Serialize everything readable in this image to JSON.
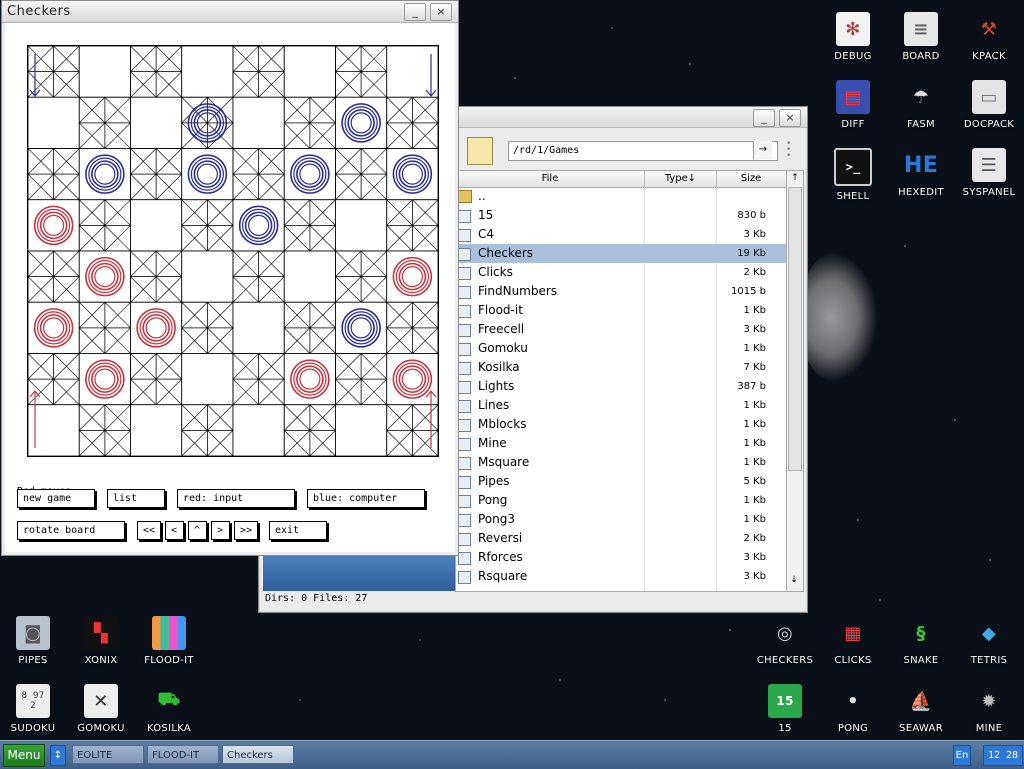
{
  "desktop": {
    "icons_top": [
      {
        "label": "DEBUG"
      },
      {
        "label": "BOARD"
      },
      {
        "label": "KPACK"
      },
      {
        "label": "DIFF"
      },
      {
        "label": "FASM"
      },
      {
        "label": "DOCPACK"
      },
      {
        "label": "SHELL"
      },
      {
        "label": "HEXEDIT"
      },
      {
        "label": "SYSPANEL"
      }
    ],
    "icons_bottom": [
      {
        "label": "PIPES"
      },
      {
        "label": "XONIX"
      },
      {
        "label": "FLOOD-IT"
      },
      {
        "label": "SUDOKU"
      },
      {
        "label": "GOMOKU"
      },
      {
        "label": "KOSILKA"
      },
      {
        "label": "CHECKERS"
      },
      {
        "label": "CLICKS"
      },
      {
        "label": "SNAKE"
      },
      {
        "label": "TETRIS"
      },
      {
        "label": "15"
      },
      {
        "label": "PONG"
      },
      {
        "label": "SEAWAR"
      },
      {
        "label": "MINE"
      }
    ],
    "hexedit_glyph": "HE",
    "shell_glyph": ">_",
    "fifteen_glyph": "15",
    "sudoku_digits": "8 97 2"
  },
  "checkers": {
    "title": "Checkers",
    "status": "Red moves.",
    "buttons": {
      "new_game": "new game",
      "list": "list",
      "red": "red: input",
      "blue": "blue: computer",
      "rotate": "rotate board",
      "first": "<<",
      "prev": "<",
      "up": "^",
      "next": ">",
      "last": ">>",
      "exit": "exit"
    },
    "pieces": [
      {
        "row": 1,
        "col": 3,
        "color": "blue"
      },
      {
        "row": 1,
        "col": 6,
        "color": "blue"
      },
      {
        "row": 2,
        "col": 1,
        "color": "blue"
      },
      {
        "row": 2,
        "col": 3,
        "color": "blue"
      },
      {
        "row": 2,
        "col": 5,
        "color": "blue"
      },
      {
        "row": 2,
        "col": 7,
        "color": "blue"
      },
      {
        "row": 3,
        "col": 0,
        "color": "red"
      },
      {
        "row": 3,
        "col": 4,
        "color": "blue"
      },
      {
        "row": 4,
        "col": 1,
        "color": "red"
      },
      {
        "row": 4,
        "col": 7,
        "color": "red"
      },
      {
        "row": 5,
        "col": 0,
        "color": "red"
      },
      {
        "row": 5,
        "col": 2,
        "color": "red"
      },
      {
        "row": 5,
        "col": 6,
        "color": "blue"
      },
      {
        "row": 6,
        "col": 1,
        "color": "red"
      },
      {
        "row": 6,
        "col": 5,
        "color": "red"
      },
      {
        "row": 6,
        "col": 7,
        "color": "red"
      }
    ]
  },
  "filemanager": {
    "path": "/rd/1/Games",
    "columns": {
      "file": "File",
      "type": "Type↓",
      "size": "Size"
    },
    "up_entry": "..",
    "files": [
      {
        "name": "15",
        "size": "830 b"
      },
      {
        "name": "C4",
        "size": "3 Kb"
      },
      {
        "name": "Checkers",
        "size": "19 Kb",
        "selected": true
      },
      {
        "name": "Clicks",
        "size": "2 Kb"
      },
      {
        "name": "FindNumbers",
        "size": "1015 b"
      },
      {
        "name": "Flood-it",
        "size": "1 Kb"
      },
      {
        "name": "Freecell",
        "size": "3 Kb"
      },
      {
        "name": "Gomoku",
        "size": "1 Kb"
      },
      {
        "name": "Kosilka",
        "size": "7 Kb"
      },
      {
        "name": "Lights",
        "size": "387 b"
      },
      {
        "name": "Lines",
        "size": "1 Kb"
      },
      {
        "name": "Mblocks",
        "size": "1 Kb"
      },
      {
        "name": "Mine",
        "size": "1 Kb"
      },
      {
        "name": "Msquare",
        "size": "1 Kb"
      },
      {
        "name": "Pipes",
        "size": "5 Kb"
      },
      {
        "name": "Pong",
        "size": "1 Kb"
      },
      {
        "name": "Pong3",
        "size": "1 Kb"
      },
      {
        "name": "Reversi",
        "size": "2 Kb"
      },
      {
        "name": "Rforces",
        "size": "3 Kb"
      },
      {
        "name": "Rsquare",
        "size": "3 Kb"
      }
    ],
    "status": "Dirs: 0   Files: 27"
  },
  "taskbar": {
    "menu": "Menu",
    "toggle": "↕",
    "tasks": [
      "EOLITE",
      "FLOOD-IT",
      "Checkers"
    ],
    "lang": "En",
    "clock": "12 28"
  },
  "window_controls": {
    "minimize": "_",
    "close": "×"
  },
  "colors": {
    "red_piece": "#c8323c",
    "blue_piece": "#2a2a9c",
    "selection": "#a8c0dc",
    "taskbar": "#4f6f95"
  }
}
